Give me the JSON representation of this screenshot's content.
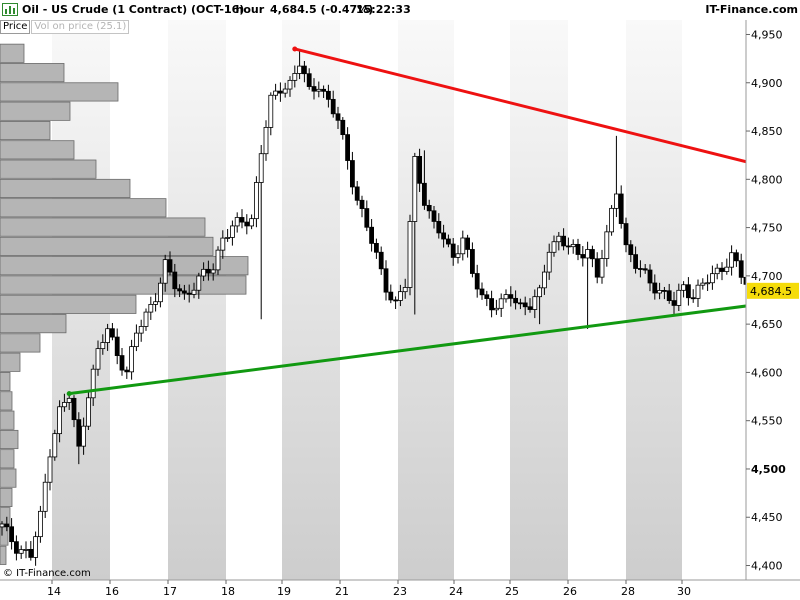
{
  "header": {
    "symbol": "Oil - US Crude (1 Contract) (OCT-16)",
    "timeframe": "1 hour",
    "last_change": "4,684.5 (-0.47%)",
    "time": "15:22:33",
    "brand": "IT-Finance.com",
    "icon": "bar-chart-icon"
  },
  "tabs": [
    {
      "label": "Price",
      "active": true
    },
    {
      "label": "Vol on price (25.1)",
      "active": false
    }
  ],
  "copyright": "© IT-Finance.com",
  "colors": {
    "candle": "#000000",
    "resistance": "#ee1111",
    "support": "#119911",
    "volume_bar": "#b5b5b5",
    "price_tag": "#f5dc0a"
  },
  "chart_data": {
    "type": "candlestick",
    "title": "Oil - US Crude (1 Contract) (OCT-16)",
    "timeframe": "1 hour",
    "ylim": [
      4385,
      4965
    ],
    "y_ticks": [
      "4,950",
      "4,900",
      "4,850",
      "4,800",
      "4,750",
      "4,700",
      "4,650",
      "4,600",
      "4,550",
      "4,500",
      "4,450",
      "4,400"
    ],
    "x_labels": [
      "14",
      "16",
      "17",
      "18",
      "19",
      "21",
      "23",
      "24",
      "25",
      "26",
      "28",
      "30"
    ],
    "last_price": 4684.5,
    "last_price_label": "4,684.5",
    "path": [
      [
        0,
        4440
      ],
      [
        1.5,
        4420
      ],
      [
        3,
        4410
      ],
      [
        4,
        4450
      ],
      [
        5,
        4520
      ],
      [
        6,
        4560
      ],
      [
        7,
        4575
      ],
      [
        8,
        4520
      ],
      [
        9,
        4580
      ],
      [
        10,
        4620
      ],
      [
        11,
        4645
      ],
      [
        12,
        4620
      ],
      [
        13,
        4600
      ],
      [
        14,
        4640
      ],
      [
        15,
        4660
      ],
      [
        16,
        4680
      ],
      [
        17,
        4710
      ],
      [
        18,
        4690
      ],
      [
        19,
        4680
      ],
      [
        20,
        4690
      ],
      [
        21,
        4700
      ],
      [
        22,
        4710
      ],
      [
        23,
        4740
      ],
      [
        24,
        4750
      ],
      [
        25,
        4755
      ],
      [
        26,
        4760
      ],
      [
        27,
        4830
      ],
      [
        28,
        4880
      ],
      [
        29,
        4895
      ],
      [
        30,
        4900
      ],
      [
        31,
        4920
      ],
      [
        32,
        4890
      ],
      [
        33,
        4900
      ],
      [
        34,
        4880
      ],
      [
        35,
        4860
      ],
      [
        36,
        4820
      ],
      [
        37,
        4780
      ],
      [
        38,
        4750
      ],
      [
        39,
        4720
      ],
      [
        40,
        4690
      ],
      [
        41,
        4670
      ],
      [
        42,
        4690
      ],
      [
        43,
        4820
      ],
      [
        44,
        4780
      ],
      [
        45,
        4750
      ],
      [
        46,
        4740
      ],
      [
        47,
        4720
      ],
      [
        48,
        4740
      ],
      [
        49,
        4700
      ],
      [
        50,
        4680
      ],
      [
        51,
        4670
      ],
      [
        52,
        4670
      ],
      [
        53,
        4680
      ],
      [
        54,
        4670
      ],
      [
        55,
        4670
      ],
      [
        56,
        4680
      ],
      [
        57,
        4730
      ],
      [
        58,
        4740
      ],
      [
        59,
        4730
      ],
      [
        60,
        4720
      ],
      [
        61,
        4730
      ],
      [
        62,
        4700
      ],
      [
        63,
        4740
      ],
      [
        64,
        4790
      ],
      [
        65,
        4730
      ],
      [
        66,
        4710
      ],
      [
        67,
        4700
      ],
      [
        68,
        4690
      ],
      [
        69,
        4680
      ],
      [
        70,
        4670
      ],
      [
        71,
        4690
      ],
      [
        72,
        4680
      ],
      [
        73,
        4690
      ],
      [
        74,
        4700
      ],
      [
        75,
        4710
      ],
      [
        76,
        4720
      ],
      [
        77,
        4700
      ],
      [
        78,
        4684.5
      ]
    ],
    "spikes": [
      [
        8,
        4505
      ],
      [
        8.5,
        4520
      ],
      [
        43,
        4660
      ],
      [
        44,
        4830
      ],
      [
        64,
        4845
      ],
      [
        56,
        4650
      ],
      [
        61,
        4645
      ],
      [
        27,
        4655
      ],
      [
        31,
        4935
      ],
      [
        36,
        4810
      ]
    ],
    "volume_profile": [
      {
        "price": 4930,
        "volume": 24
      },
      {
        "price": 4910,
        "volume": 64
      },
      {
        "price": 4890,
        "volume": 118
      },
      {
        "price": 4870,
        "volume": 70
      },
      {
        "price": 4850,
        "volume": 50
      },
      {
        "price": 4830,
        "volume": 74
      },
      {
        "price": 4810,
        "volume": 96
      },
      {
        "price": 4790,
        "volume": 130
      },
      {
        "price": 4770,
        "volume": 166
      },
      {
        "price": 4750,
        "volume": 205
      },
      {
        "price": 4730,
        "volume": 213
      },
      {
        "price": 4710,
        "volume": 248
      },
      {
        "price": 4690,
        "volume": 246
      },
      {
        "price": 4670,
        "volume": 136
      },
      {
        "price": 4650,
        "volume": 66
      },
      {
        "price": 4630,
        "volume": 40
      },
      {
        "price": 4610,
        "volume": 20
      },
      {
        "price": 4590,
        "volume": 10
      },
      {
        "price": 4570,
        "volume": 12
      },
      {
        "price": 4550,
        "volume": 14
      },
      {
        "price": 4530,
        "volume": 18
      },
      {
        "price": 4510,
        "volume": 14
      },
      {
        "price": 4490,
        "volume": 16
      },
      {
        "price": 4470,
        "volume": 12
      },
      {
        "price": 4450,
        "volume": 10
      },
      {
        "price": 4430,
        "volume": 8
      },
      {
        "price": 4410,
        "volume": 6
      }
    ],
    "trendlines": [
      {
        "name": "resistance",
        "from": [
          30.5,
          4935
        ],
        "to": [
          80,
          4812
        ]
      },
      {
        "name": "support",
        "from": [
          7,
          4578
        ],
        "to": [
          80,
          4672
        ]
      }
    ]
  }
}
